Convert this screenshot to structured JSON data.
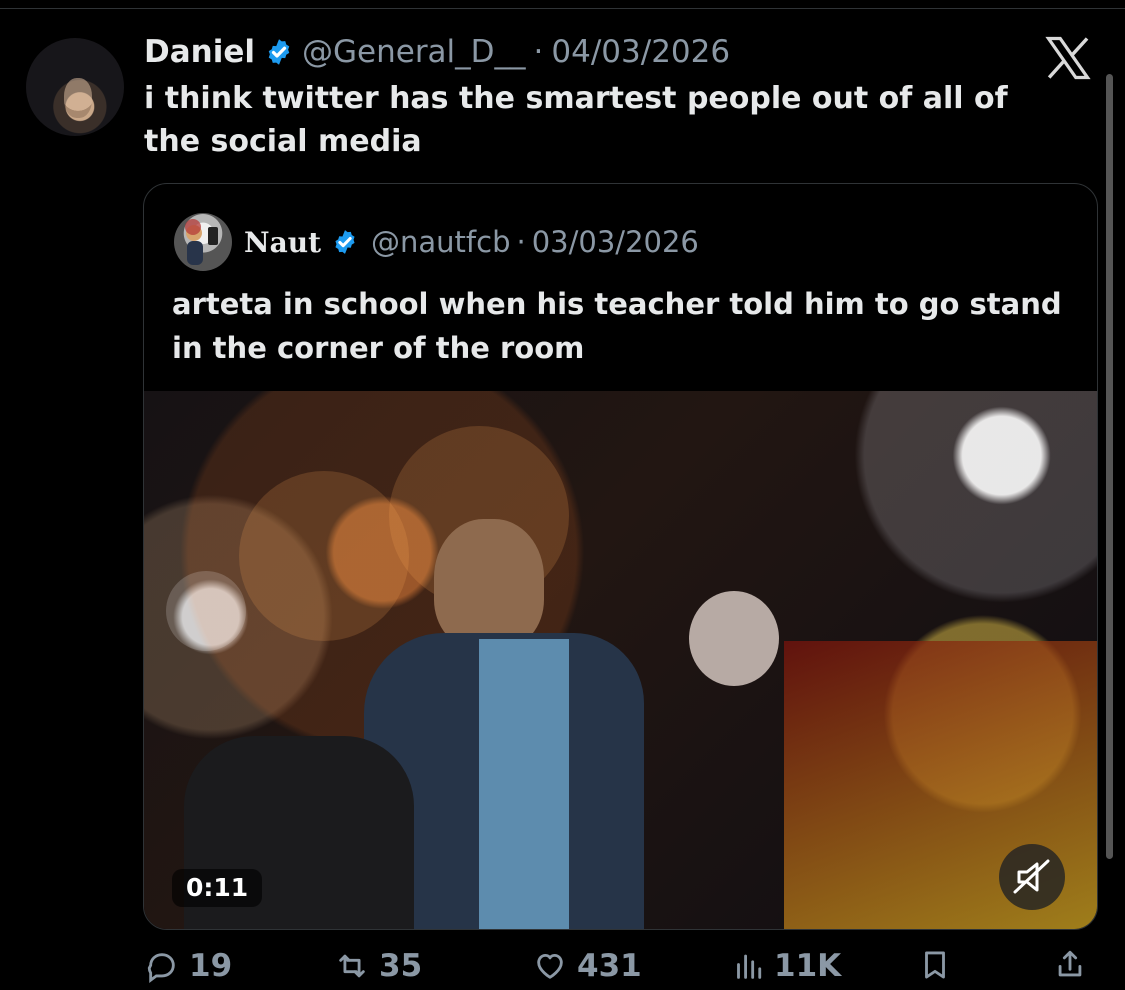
{
  "tweet": {
    "author_name": "Daniel",
    "handle": "@General_D__",
    "separator": "·",
    "date": "04/03/2026",
    "text": "i think twitter has the smartest people out of all of the social media"
  },
  "quote": {
    "author_name": "Naut",
    "handle": "@nautfcb",
    "separator": "·",
    "date": "03/03/2026",
    "text": "arteta in school when his teacher told him to go stand in the corner of the room",
    "video": {
      "duration": "0:11"
    }
  },
  "actions": {
    "replies": "19",
    "reposts": "35",
    "likes": "431",
    "views": "11K"
  },
  "icons": {
    "verified": "verified-badge-icon",
    "x_logo": "x-logo-icon",
    "reply": "reply-icon",
    "repost": "repost-icon",
    "like": "heart-icon",
    "views": "views-bar-chart-icon",
    "bookmark": "bookmark-icon",
    "share": "share-icon",
    "mute": "muted-speaker-icon"
  },
  "colors": {
    "background": "#000000",
    "text": "#e7e9ea",
    "secondary": "#8b98a5",
    "verified": "#1d9bf0",
    "border": "#2f3336"
  }
}
